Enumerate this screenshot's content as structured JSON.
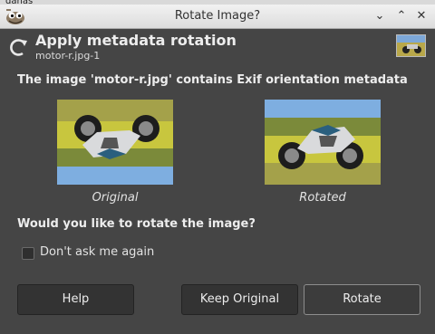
{
  "background": {
    "label": "danas"
  },
  "window": {
    "title": "Rotate Image?",
    "controls": {
      "minimize": "⌄",
      "maximize": "⌃",
      "close": "✕"
    }
  },
  "header": {
    "title": "Apply metadata rotation",
    "subtitle": "motor-r.jpg-1"
  },
  "message": "The image 'motor-r.jpg' contains Exif orientation metadata",
  "previews": {
    "original_caption": "Original",
    "rotated_caption": "Rotated"
  },
  "question": "Would you like to rotate the image?",
  "dont_ask": {
    "label": "Don't ask me again",
    "checked": false
  },
  "buttons": {
    "help": "Help",
    "keep": "Keep Original",
    "rotate": "Rotate"
  },
  "colors": {
    "dialog_bg": "#454545",
    "button_bg": "#333333",
    "text": "#ededed"
  },
  "icons": {
    "app": "gimp-icon",
    "header": "rotate-arrow-icon"
  }
}
